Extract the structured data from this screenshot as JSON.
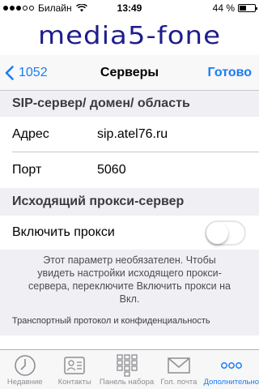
{
  "status": {
    "carrier": "Билайн",
    "time": "13:49",
    "battery_text": "44 %",
    "battery_level": 0.44,
    "signal_filled": 3
  },
  "brand": {
    "logo": "media5-fone",
    "logo_color": "#1d1d8c"
  },
  "nav": {
    "back_label": "1052",
    "title": "Серверы",
    "done_label": "Готово",
    "accent": "#1a7cf5"
  },
  "sections": {
    "sip_header": "SIP-сервер/ домен/ область",
    "address_label": "Адрес",
    "address_value": "sip.atel76.ru",
    "port_label": "Порт",
    "port_value": "5060",
    "proxy_header": "Исходящий прокси-сервер",
    "enable_proxy_label": "Включить прокси",
    "enable_proxy_on": false,
    "proxy_note": "Этот параметр необязателен. Чтобы увидеть настройки исходящего прокси-сервера, переключите Включить прокси на Вкл.",
    "transport_header": "Транспортный протокол и конфиденциальность"
  },
  "tabs": [
    {
      "label": "Недавние",
      "icon": "clock-icon"
    },
    {
      "label": "Контакты",
      "icon": "contacts-icon"
    },
    {
      "label": "Панель набора",
      "icon": "keypad-icon"
    },
    {
      "label": "Гол. почта",
      "icon": "voicemail-icon"
    },
    {
      "label": "Дополнительно",
      "icon": "more-icon",
      "active": true
    }
  ]
}
